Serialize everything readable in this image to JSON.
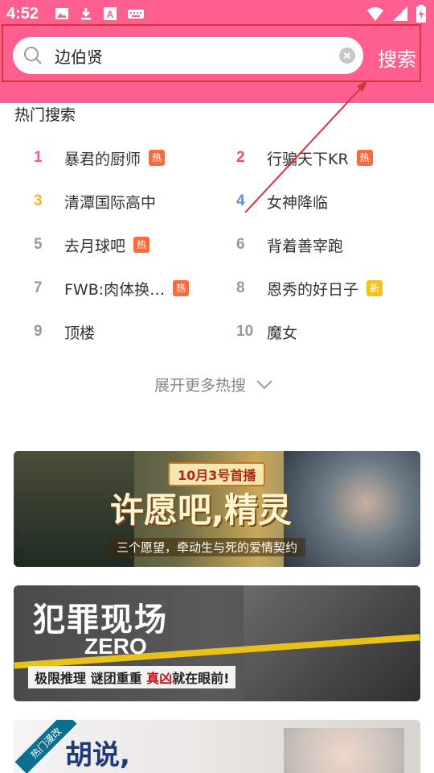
{
  "status_bar": {
    "time": "4:52"
  },
  "search": {
    "value": "边伯贤",
    "button_label": "搜索"
  },
  "hot": {
    "title": "热门搜索",
    "items": [
      {
        "rank": "1",
        "title": "暴君的厨师",
        "badge": "热",
        "rank_color": "#ff5a86",
        "badge_color": "#ff6a3d"
      },
      {
        "rank": "2",
        "title": "行骗天下KR",
        "badge": "热",
        "rank_color": "#ff4d5a",
        "badge_color": "#ff6a3d"
      },
      {
        "rank": "3",
        "title": "清潭国际高中",
        "badge": "",
        "rank_color": "#ffae2a",
        "badge_color": ""
      },
      {
        "rank": "4",
        "title": "女神降临",
        "badge": "",
        "rank_color": "#5b8df2",
        "badge_color": ""
      },
      {
        "rank": "5",
        "title": "去月球吧",
        "badge": "热",
        "rank_color": "#999999",
        "badge_color": "#ff6a3d"
      },
      {
        "rank": "6",
        "title": "背着善宰跑",
        "badge": "",
        "rank_color": "#999999",
        "badge_color": ""
      },
      {
        "rank": "7",
        "title": "FWB:肉体换…",
        "badge": "热",
        "rank_color": "#999999",
        "badge_color": "#ff6a3d"
      },
      {
        "rank": "8",
        "title": "恩秀的好日子",
        "badge": "新",
        "rank_color": "#999999",
        "badge_color": "#f8c21c"
      },
      {
        "rank": "9",
        "title": "顶楼",
        "badge": "",
        "rank_color": "#999999",
        "badge_color": ""
      },
      {
        "rank": "10",
        "title": "魔女",
        "badge": "",
        "rank_color": "#999999",
        "badge_color": ""
      }
    ],
    "expand_label": "展开更多热搜"
  },
  "banners": [
    {
      "date": "10月3号首播",
      "title": "许愿吧,精灵",
      "subtitle": "三个愿望，牵动生与死的爱情契约"
    },
    {
      "title": "犯罪现场",
      "subtitle_en": "ZERO",
      "tagline_a": "极限推理 谜团重重 ",
      "tagline_b": "真凶",
      "tagline_c": "就在眼前!"
    },
    {
      "tag": "热门漫改",
      "title": "胡说,"
    }
  ]
}
